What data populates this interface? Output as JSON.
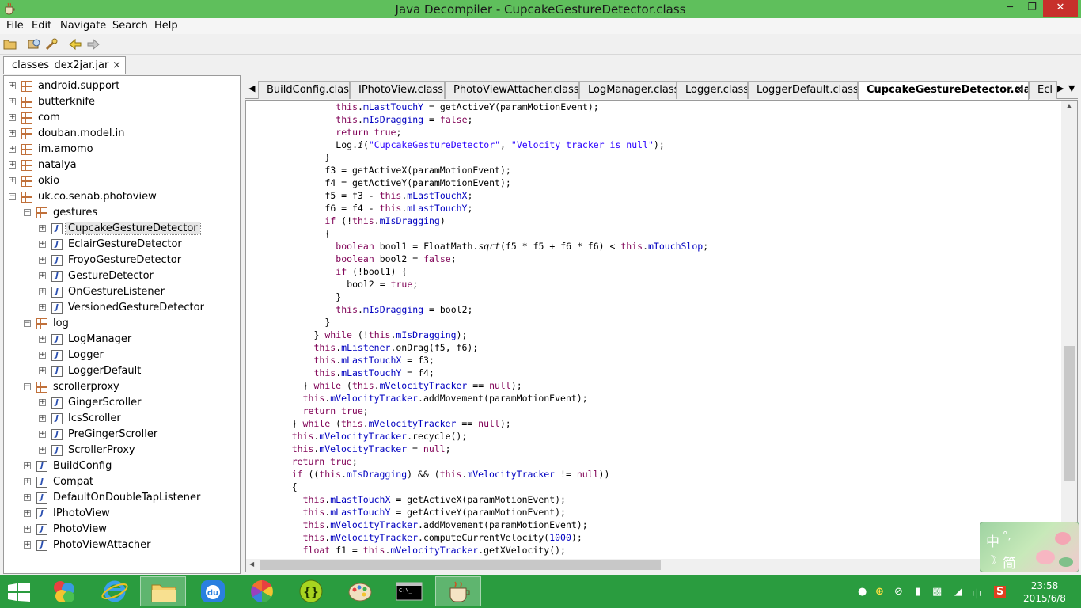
{
  "window": {
    "title": "Java Decompiler - CupcakeGestureDetector.class"
  },
  "menu": [
    "File",
    "Edit",
    "Navigate",
    "Search",
    "Help"
  ],
  "file_tab": {
    "label": "classes_dex2jar.jar",
    "close": "×"
  },
  "tree": [
    {
      "label": "android.support",
      "type": "package",
      "level": 0
    },
    {
      "label": "butterknife",
      "type": "package",
      "level": 0
    },
    {
      "label": "com",
      "type": "package",
      "level": 0
    },
    {
      "label": "douban.model.in",
      "type": "package",
      "level": 0
    },
    {
      "label": "im.amomo",
      "type": "package",
      "level": 0
    },
    {
      "label": "natalya",
      "type": "package",
      "level": 0
    },
    {
      "label": "okio",
      "type": "package",
      "level": 0
    },
    {
      "label": "uk.co.senab.photoview",
      "type": "package",
      "level": 0,
      "expanded": true
    },
    {
      "label": "gestures",
      "type": "package",
      "level": 1,
      "expanded": true
    },
    {
      "label": "CupcakeGestureDetector",
      "type": "class",
      "level": 2,
      "selected": true
    },
    {
      "label": "EclairGestureDetector",
      "type": "class",
      "level": 2
    },
    {
      "label": "FroyoGestureDetector",
      "type": "class",
      "level": 2
    },
    {
      "label": "GestureDetector",
      "type": "class",
      "level": 2
    },
    {
      "label": "OnGestureListener",
      "type": "class",
      "level": 2
    },
    {
      "label": "VersionedGestureDetector",
      "type": "class",
      "level": 2
    },
    {
      "label": "log",
      "type": "package",
      "level": 1,
      "expanded": true
    },
    {
      "label": "LogManager",
      "type": "class",
      "level": 2
    },
    {
      "label": "Logger",
      "type": "class",
      "level": 2
    },
    {
      "label": "LoggerDefault",
      "type": "class",
      "level": 2
    },
    {
      "label": "scrollerproxy",
      "type": "package",
      "level": 1,
      "expanded": true
    },
    {
      "label": "GingerScroller",
      "type": "class",
      "level": 2
    },
    {
      "label": "IcsScroller",
      "type": "class",
      "level": 2
    },
    {
      "label": "PreGingerScroller",
      "type": "class",
      "level": 2
    },
    {
      "label": "ScrollerProxy",
      "type": "class",
      "level": 2
    },
    {
      "label": "BuildConfig",
      "type": "class",
      "level": 1
    },
    {
      "label": "Compat",
      "type": "class",
      "level": 1
    },
    {
      "label": "DefaultOnDoubleTapListener",
      "type": "class",
      "level": 1
    },
    {
      "label": "IPhotoView",
      "type": "class",
      "level": 1
    },
    {
      "label": "PhotoView",
      "type": "class",
      "level": 1
    },
    {
      "label": "PhotoViewAttacher",
      "type": "class",
      "level": 1
    }
  ],
  "editor_tabs": [
    {
      "label": "BuildConfig.class"
    },
    {
      "label": "IPhotoView.class"
    },
    {
      "label": "PhotoViewAttacher.class"
    },
    {
      "label": "LogManager.class"
    },
    {
      "label": "Logger.class"
    },
    {
      "label": "LoggerDefault.class"
    },
    {
      "label": "CupcakeGestureDetector.class",
      "active": true,
      "close": "×"
    },
    {
      "label": "Ecl"
    }
  ],
  "code": [
    {
      "indent": 14,
      "parts": [
        [
          "kw",
          "this"
        ],
        [
          "",
          "."
        ],
        [
          "fld",
          "mLastTouchY"
        ],
        [
          "",
          " = getActiveY(paramMotionEvent);"
        ]
      ]
    },
    {
      "indent": 14,
      "parts": [
        [
          "kw",
          "this"
        ],
        [
          "",
          "."
        ],
        [
          "fld",
          "mIsDragging"
        ],
        [
          "",
          " = "
        ],
        [
          "kw",
          "false"
        ],
        [
          "",
          ";"
        ]
      ]
    },
    {
      "indent": 14,
      "parts": [
        [
          "kw",
          "return true"
        ],
        [
          "",
          ";"
        ]
      ]
    },
    {
      "indent": 14,
      "parts": [
        [
          "",
          "Log."
        ],
        [
          "it",
          "i"
        ],
        [
          "",
          "("
        ],
        [
          "st",
          "\"CupcakeGestureDetector\""
        ],
        [
          "",
          ", "
        ],
        [
          "st",
          "\"Velocity tracker is null\""
        ],
        [
          "",
          ");"
        ]
      ]
    },
    {
      "indent": 12,
      "parts": [
        [
          "",
          "}"
        ]
      ]
    },
    {
      "indent": 12,
      "parts": [
        [
          "",
          "f3 = getActiveX(paramMotionEvent);"
        ]
      ]
    },
    {
      "indent": 12,
      "parts": [
        [
          "",
          "f4 = getActiveY(paramMotionEvent);"
        ]
      ]
    },
    {
      "indent": 12,
      "parts": [
        [
          "",
          "f5 = f3 - "
        ],
        [
          "kw",
          "this"
        ],
        [
          "",
          "."
        ],
        [
          "fld",
          "mLastTouchX"
        ],
        [
          "",
          ";"
        ]
      ]
    },
    {
      "indent": 12,
      "parts": [
        [
          "",
          "f6 = f4 - "
        ],
        [
          "kw",
          "this"
        ],
        [
          "",
          "."
        ],
        [
          "fld",
          "mLastTouchY"
        ],
        [
          "",
          ";"
        ]
      ]
    },
    {
      "indent": 12,
      "parts": [
        [
          "kw",
          "if"
        ],
        [
          "",
          " (!"
        ],
        [
          "kw",
          "this"
        ],
        [
          "",
          "."
        ],
        [
          "fld",
          "mIsDragging"
        ],
        [
          "",
          ")"
        ]
      ]
    },
    {
      "indent": 12,
      "parts": [
        [
          "",
          "{"
        ]
      ]
    },
    {
      "indent": 14,
      "parts": [
        [
          "kw",
          "boolean"
        ],
        [
          "",
          " bool1 = FloatMath."
        ],
        [
          "it",
          "sqrt"
        ],
        [
          "",
          "(f5 * f5 + f6 * f6) < "
        ],
        [
          "kw",
          "this"
        ],
        [
          "",
          "."
        ],
        [
          "fld",
          "mTouchSlop"
        ],
        [
          "",
          ";"
        ]
      ]
    },
    {
      "indent": 14,
      "parts": [
        [
          "kw",
          "boolean"
        ],
        [
          "",
          " bool2 = "
        ],
        [
          "kw",
          "false"
        ],
        [
          "",
          ";"
        ]
      ]
    },
    {
      "indent": 14,
      "parts": [
        [
          "kw",
          "if"
        ],
        [
          "",
          " (!bool1) {"
        ]
      ]
    },
    {
      "indent": 16,
      "parts": [
        [
          "",
          "bool2 = "
        ],
        [
          "kw",
          "true"
        ],
        [
          "",
          ";"
        ]
      ]
    },
    {
      "indent": 14,
      "parts": [
        [
          "",
          "}"
        ]
      ]
    },
    {
      "indent": 14,
      "parts": [
        [
          "kw",
          "this"
        ],
        [
          "",
          "."
        ],
        [
          "fld",
          "mIsDragging"
        ],
        [
          "",
          " = bool2;"
        ]
      ]
    },
    {
      "indent": 12,
      "parts": [
        [
          "",
          "}"
        ]
      ]
    },
    {
      "indent": 10,
      "parts": [
        [
          "",
          "} "
        ],
        [
          "kw",
          "while"
        ],
        [
          "",
          " (!"
        ],
        [
          "kw",
          "this"
        ],
        [
          "",
          "."
        ],
        [
          "fld",
          "mIsDragging"
        ],
        [
          "",
          ");"
        ]
      ]
    },
    {
      "indent": 10,
      "parts": [
        [
          "kw",
          "this"
        ],
        [
          "",
          "."
        ],
        [
          "fld",
          "mListener"
        ],
        [
          "",
          ".onDrag(f5, f6);"
        ]
      ]
    },
    {
      "indent": 10,
      "parts": [
        [
          "kw",
          "this"
        ],
        [
          "",
          "."
        ],
        [
          "fld",
          "mLastTouchX"
        ],
        [
          "",
          " = f3;"
        ]
      ]
    },
    {
      "indent": 10,
      "parts": [
        [
          "kw",
          "this"
        ],
        [
          "",
          "."
        ],
        [
          "fld",
          "mLastTouchY"
        ],
        [
          "",
          " = f4;"
        ]
      ]
    },
    {
      "indent": 8,
      "parts": [
        [
          "",
          "} "
        ],
        [
          "kw",
          "while"
        ],
        [
          "",
          " ("
        ],
        [
          "kw",
          "this"
        ],
        [
          "",
          "."
        ],
        [
          "fld",
          "mVelocityTracker"
        ],
        [
          "",
          " == "
        ],
        [
          "kw",
          "null"
        ],
        [
          "",
          ");"
        ]
      ]
    },
    {
      "indent": 8,
      "parts": [
        [
          "kw",
          "this"
        ],
        [
          "",
          "."
        ],
        [
          "fld",
          "mVelocityTracker"
        ],
        [
          "",
          ".addMovement(paramMotionEvent);"
        ]
      ]
    },
    {
      "indent": 8,
      "parts": [
        [
          "kw",
          "return true"
        ],
        [
          "",
          ";"
        ]
      ]
    },
    {
      "indent": 6,
      "parts": [
        [
          "",
          "} "
        ],
        [
          "kw",
          "while"
        ],
        [
          "",
          " ("
        ],
        [
          "kw",
          "this"
        ],
        [
          "",
          "."
        ],
        [
          "fld",
          "mVelocityTracker"
        ],
        [
          "",
          " == "
        ],
        [
          "kw",
          "null"
        ],
        [
          "",
          ");"
        ]
      ]
    },
    {
      "indent": 6,
      "parts": [
        [
          "kw",
          "this"
        ],
        [
          "",
          "."
        ],
        [
          "fld",
          "mVelocityTracker"
        ],
        [
          "",
          ".recycle();"
        ]
      ]
    },
    {
      "indent": 6,
      "parts": [
        [
          "kw",
          "this"
        ],
        [
          "",
          "."
        ],
        [
          "fld",
          "mVelocityTracker"
        ],
        [
          "",
          " = "
        ],
        [
          "kw",
          "null"
        ],
        [
          "",
          ";"
        ]
      ]
    },
    {
      "indent": 6,
      "parts": [
        [
          "kw",
          "return true"
        ],
        [
          "",
          ";"
        ]
      ]
    },
    {
      "indent": 6,
      "parts": [
        [
          "kw",
          "if"
        ],
        [
          "",
          " (("
        ],
        [
          "kw",
          "this"
        ],
        [
          "",
          "."
        ],
        [
          "fld",
          "mIsDragging"
        ],
        [
          "",
          ") && ("
        ],
        [
          "kw",
          "this"
        ],
        [
          "",
          "."
        ],
        [
          "fld",
          "mVelocityTracker"
        ],
        [
          "",
          " != "
        ],
        [
          "kw",
          "null"
        ],
        [
          "",
          "))"
        ]
      ]
    },
    {
      "indent": 6,
      "parts": [
        [
          "",
          "{"
        ]
      ]
    },
    {
      "indent": 8,
      "parts": [
        [
          "kw",
          "this"
        ],
        [
          "",
          "."
        ],
        [
          "fld",
          "mLastTouchX"
        ],
        [
          "",
          " = getActiveX(paramMotionEvent);"
        ]
      ]
    },
    {
      "indent": 8,
      "parts": [
        [
          "kw",
          "this"
        ],
        [
          "",
          "."
        ],
        [
          "fld",
          "mLastTouchY"
        ],
        [
          "",
          " = getActiveY(paramMotionEvent);"
        ]
      ]
    },
    {
      "indent": 8,
      "parts": [
        [
          "kw",
          "this"
        ],
        [
          "",
          "."
        ],
        [
          "fld",
          "mVelocityTracker"
        ],
        [
          "",
          ".addMovement(paramMotionEvent);"
        ]
      ]
    },
    {
      "indent": 8,
      "parts": [
        [
          "kw",
          "this"
        ],
        [
          "",
          "."
        ],
        [
          "fld",
          "mVelocityTracker"
        ],
        [
          "",
          ".computeCurrentVelocity("
        ],
        [
          "fld",
          "1000"
        ],
        [
          "",
          ");"
        ]
      ]
    },
    {
      "indent": 8,
      "parts": [
        [
          "kw",
          "float"
        ],
        [
          "",
          " f1 = "
        ],
        [
          "kw",
          "this"
        ],
        [
          "",
          "."
        ],
        [
          "fld",
          "mVelocityTracker"
        ],
        [
          "",
          ".getXVelocity();"
        ]
      ]
    }
  ],
  "ime": {
    "c1": "中",
    "c2": "°,",
    "c3": "☽",
    "c4": "简"
  },
  "taskbar_apps": [
    "start",
    "color-balls",
    "internet-explorer",
    "file-explorer",
    "baidu-du",
    "color-wheel",
    "json-braces",
    "paint-palette",
    "command-prompt",
    "java-decompiler"
  ],
  "tray": {
    "ime_lang": "中",
    "antivirus": "S"
  },
  "clock": {
    "time": "23:58",
    "date": "2015/6/8"
  }
}
